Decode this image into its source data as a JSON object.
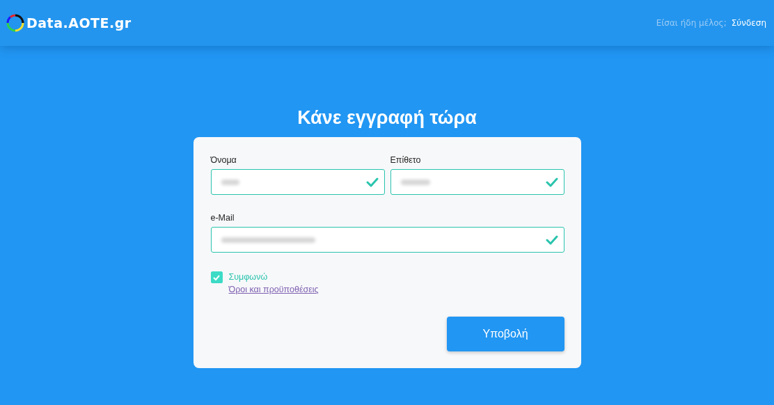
{
  "header": {
    "logo": "Data.AOTE.gr",
    "member_prompt": "Είσαι ήδη μέλος;",
    "login_link": "Σύνδεση"
  },
  "title": "Κάνε εγγραφή τώρα",
  "form": {
    "fields": [
      {
        "label": "Όνομα",
        "valid": true,
        "value_hidden": true
      },
      {
        "label": "Επίθετο",
        "valid": true,
        "value_hidden": true
      },
      {
        "label": "e-Mail",
        "valid": true,
        "value_hidden": true
      }
    ],
    "agree": {
      "label": "Συμφωνώ",
      "checked": true
    },
    "terms_link": "Όροι και προϋποθέσεις",
    "submit": "Υποβολή"
  }
}
